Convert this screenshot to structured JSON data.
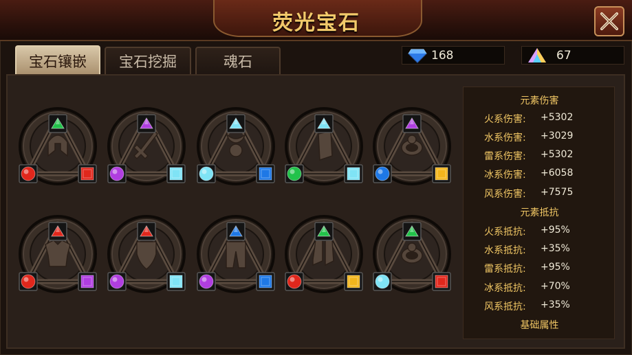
{
  "window": {
    "title": "荧光宝石"
  },
  "tabs": [
    {
      "label": "宝石镶嵌",
      "active": true
    },
    {
      "label": "宝石挖掘",
      "active": false
    },
    {
      "label": "魂石",
      "active": false
    }
  ],
  "currency": [
    {
      "icon": "diamond-icon",
      "value": "168"
    },
    {
      "icon": "prism-crystal-icon",
      "value": "67"
    }
  ],
  "slots": [
    {
      "item": "helmet-icon",
      "top": "green",
      "left": "red",
      "right": "red"
    },
    {
      "item": "sword-icon",
      "top": "purple",
      "left": "purple",
      "right": "cyan"
    },
    {
      "item": "amulet-icon",
      "top": "cyan",
      "left": "cyan",
      "right": "blue"
    },
    {
      "item": "bracer-icon",
      "top": "cyan",
      "left": "green",
      "right": "cyan"
    },
    {
      "item": "ring-icon",
      "top": "purple",
      "left": "blue",
      "right": "yellow"
    },
    {
      "item": "armor-icon",
      "top": "red",
      "left": "red",
      "right": "purple"
    },
    {
      "item": "shield-icon",
      "top": "red",
      "left": "purple",
      "right": "cyan"
    },
    {
      "item": "pants-icon",
      "top": "blue",
      "left": "purple",
      "right": "blue"
    },
    {
      "item": "boots-icon",
      "top": "green",
      "left": "red",
      "right": "yellow"
    },
    {
      "item": "ring-icon",
      "top": "green",
      "left": "cyan",
      "right": "red"
    }
  ],
  "gem_colors": {
    "red": "#e0271c",
    "green": "#22c24a",
    "purple": "#b03ee0",
    "cyan": "#7fe3f5",
    "blue": "#1e78e6",
    "yellow": "#f2b51c"
  },
  "stats": {
    "damage_heading": "元素伤害",
    "damage": [
      {
        "label": "火系伤害:",
        "value": "+5302"
      },
      {
        "label": "水系伤害:",
        "value": "+3029"
      },
      {
        "label": "雷系伤害:",
        "value": "+5302"
      },
      {
        "label": "冰系伤害:",
        "value": "+6058"
      },
      {
        "label": "风系伤害:",
        "value": "+7575"
      }
    ],
    "resist_heading": "元素抵抗",
    "resist": [
      {
        "label": "火系抵抗:",
        "value": "+95%"
      },
      {
        "label": "水系抵抗:",
        "value": "+35%"
      },
      {
        "label": "雷系抵抗:",
        "value": "+95%"
      },
      {
        "label": "冰系抵抗:",
        "value": "+70%"
      },
      {
        "label": "风系抵抗:",
        "value": "+35%"
      }
    ],
    "base_heading": "基础属性"
  }
}
